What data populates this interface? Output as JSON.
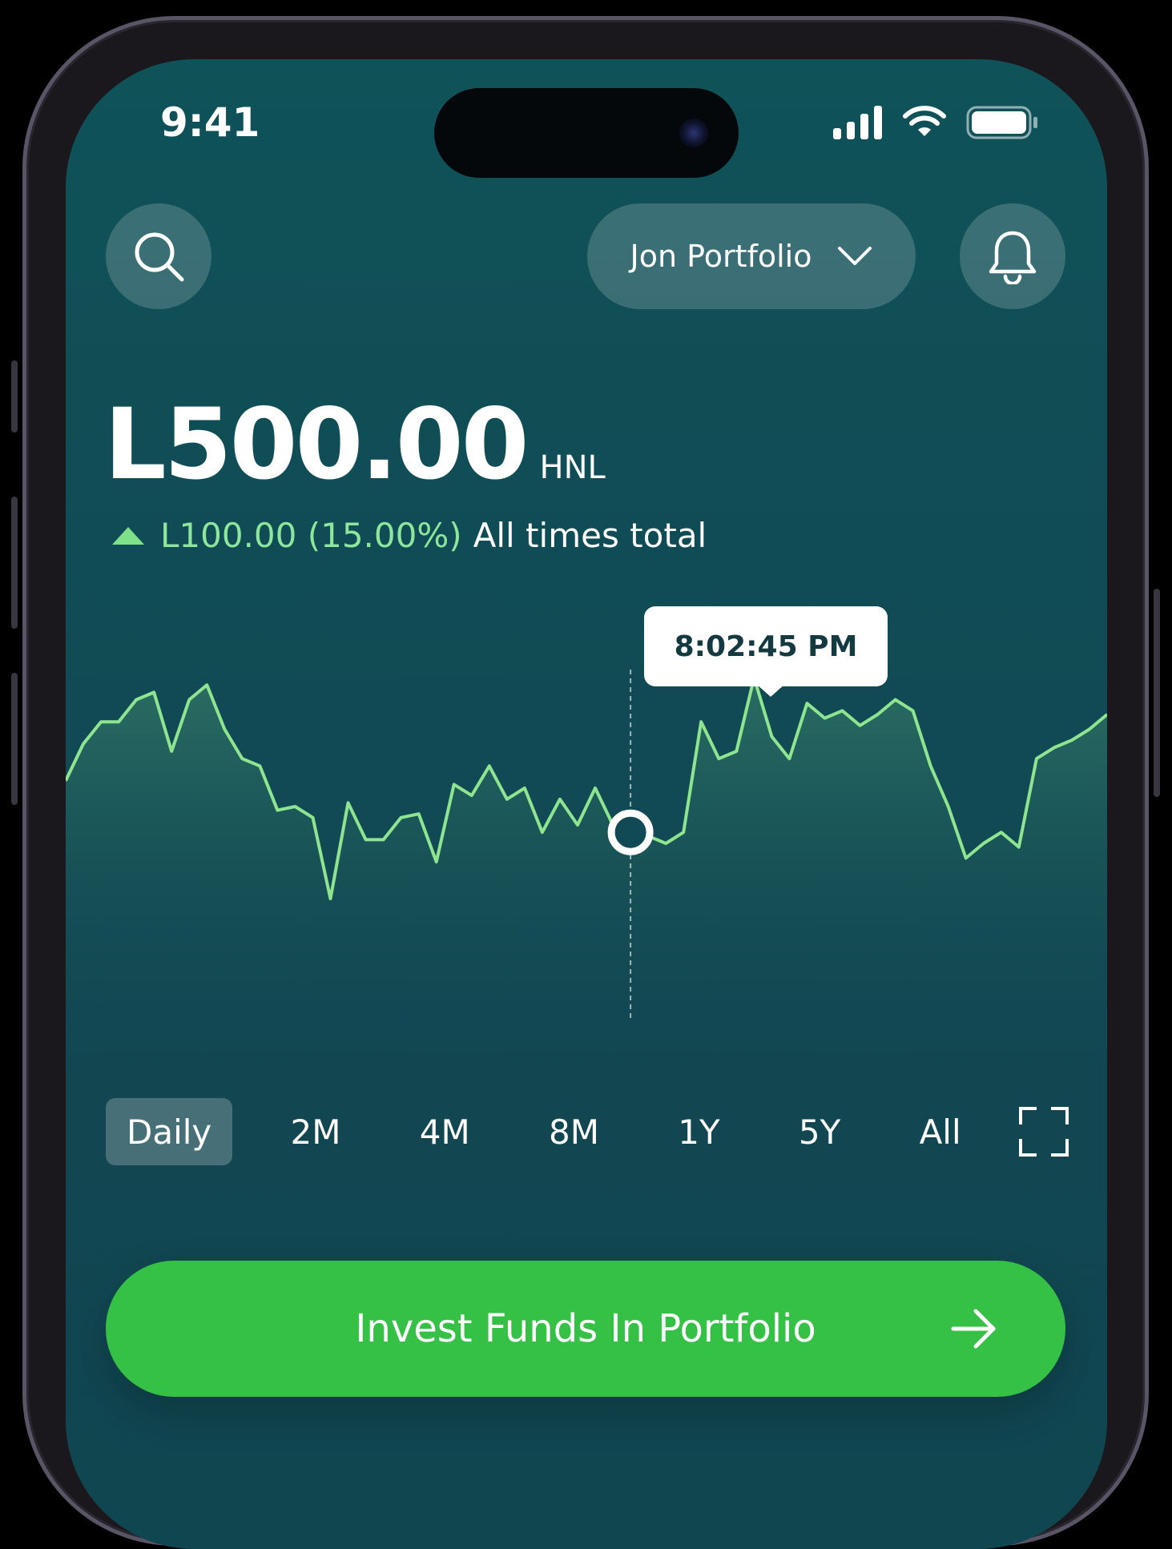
{
  "status_bar": {
    "time": "9:41"
  },
  "header": {
    "portfolio_label": "Jon Portfolio"
  },
  "balance": {
    "amount": "L500.00",
    "currency": "HNL",
    "change": "L100.00 (15.00%)",
    "change_desc": "All times total"
  },
  "tooltip": {
    "time": "8:02:45 PM"
  },
  "ranges": [
    {
      "label": "Daily",
      "active": true
    },
    {
      "label": "2M",
      "active": false
    },
    {
      "label": "4M",
      "active": false
    },
    {
      "label": "8M",
      "active": false
    },
    {
      "label": "1Y",
      "active": false
    },
    {
      "label": "5Y",
      "active": false
    },
    {
      "label": "All",
      "active": false
    }
  ],
  "cta": {
    "label": "Invest Funds In Portfolio"
  },
  "colors": {
    "background": "#0f5258",
    "line": "#8fe58f",
    "accent_green": "#35c145"
  },
  "chart_data": {
    "type": "area",
    "x": [
      0,
      1,
      2,
      3,
      4,
      5,
      6,
      7,
      8,
      9,
      10,
      11,
      12,
      13,
      14,
      15,
      16,
      17,
      18,
      19,
      20,
      21,
      22,
      23,
      24,
      25,
      26,
      27,
      28,
      29,
      30,
      31,
      32,
      33,
      34,
      35,
      36,
      37,
      38,
      39,
      40,
      41,
      42,
      43,
      44,
      45,
      46,
      47,
      48,
      49,
      50,
      51,
      52,
      53,
      54,
      55,
      56,
      57,
      58,
      59
    ],
    "values": [
      52,
      62,
      68,
      68,
      74,
      76,
      60,
      74,
      78,
      66,
      58,
      56,
      44,
      45,
      42,
      20,
      46,
      36,
      36,
      42,
      43,
      30,
      51,
      48,
      56,
      47,
      50,
      38,
      47,
      40,
      50,
      40,
      38,
      37,
      35,
      38,
      68,
      58,
      60,
      80,
      64,
      58,
      73,
      69,
      71,
      67,
      70,
      74,
      71,
      56,
      45,
      31,
      35,
      38,
      34,
      58,
      61,
      63,
      66,
      70
    ],
    "selected_index": 32,
    "ylim": [
      0,
      100
    ],
    "grid": false,
    "legend": "none"
  }
}
